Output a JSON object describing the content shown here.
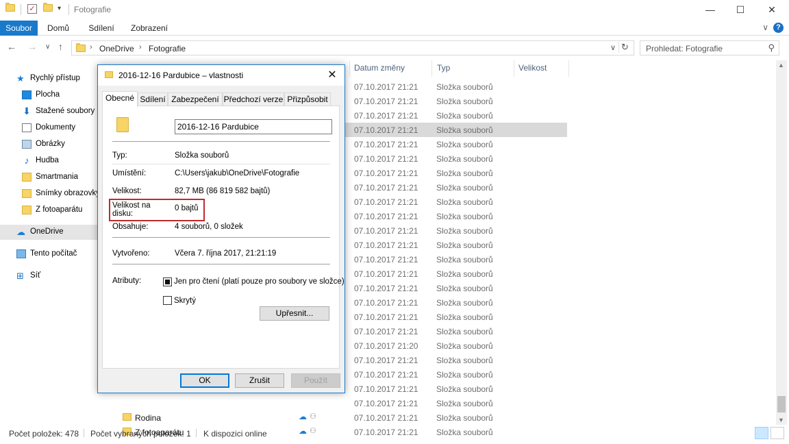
{
  "window": {
    "title": "Fotografie",
    "minimize": "—",
    "maximize": "☐",
    "close": "✕"
  },
  "ribbon": {
    "tabs": [
      "Soubor",
      "Domů",
      "Sdílení",
      "Zobrazení"
    ],
    "collapse": "∨",
    "help": "?"
  },
  "address": {
    "crumbs": [
      "OneDrive",
      "Fotografie"
    ],
    "search_placeholder": "Prohledat: Fotografie"
  },
  "nav": {
    "items": [
      {
        "label": "Rychlý přístup",
        "icon": "star-icon"
      },
      {
        "label": "Plocha",
        "icon": "desktop-icon"
      },
      {
        "label": "Stažené soubory",
        "icon": "download-icon"
      },
      {
        "label": "Dokumenty",
        "icon": "documents-icon"
      },
      {
        "label": "Obrázky",
        "icon": "pictures-icon"
      },
      {
        "label": "Hudba",
        "icon": "music-icon"
      },
      {
        "label": "Smartmania",
        "icon": "folder-icon"
      },
      {
        "label": "Snímky obrazovky",
        "icon": "folder-icon"
      },
      {
        "label": "Z fotoaparátu",
        "icon": "folder-icon"
      },
      {
        "label": "OneDrive",
        "icon": "cloud-icon"
      },
      {
        "label": "Tento počítač",
        "icon": "computer-icon"
      },
      {
        "label": "Síť",
        "icon": "network-icon"
      }
    ]
  },
  "columns": {
    "date": "Datum změny",
    "type": "Typ",
    "size": "Velikost"
  },
  "rows": [
    {
      "name": "",
      "date": "07.10.2017 21:21",
      "type": "Složka souborů"
    },
    {
      "name": "",
      "date": "07.10.2017 21:21",
      "type": "Složka souborů"
    },
    {
      "name": "",
      "date": "07.10.2017 21:21",
      "type": "Složka souborů"
    },
    {
      "name": "",
      "date": "07.10.2017 21:21",
      "type": "Složka souborů"
    },
    {
      "name": "",
      "date": "07.10.2017 21:21",
      "type": "Složka souborů"
    },
    {
      "name": "",
      "date": "07.10.2017 21:21",
      "type": "Složka souborů"
    },
    {
      "name": "",
      "date": "07.10.2017 21:21",
      "type": "Složka souborů"
    },
    {
      "name": "",
      "date": "07.10.2017 21:21",
      "type": "Složka souborů"
    },
    {
      "name": "",
      "date": "07.10.2017 21:21",
      "type": "Složka souborů"
    },
    {
      "name": "",
      "date": "07.10.2017 21:21",
      "type": "Složka souborů"
    },
    {
      "name": "",
      "date": "07.10.2017 21:21",
      "type": "Složka souborů"
    },
    {
      "name": "",
      "date": "07.10.2017 21:21",
      "type": "Složka souborů"
    },
    {
      "name": "",
      "date": "07.10.2017 21:21",
      "type": "Složka souborů"
    },
    {
      "name": "",
      "date": "07.10.2017 21:21",
      "type": "Složka souborů"
    },
    {
      "name": "",
      "date": "07.10.2017 21:21",
      "type": "Složka souborů"
    },
    {
      "name": "",
      "date": "07.10.2017 21:21",
      "type": "Složka souborů"
    },
    {
      "name": "",
      "date": "07.10.2017 21:21",
      "type": "Složka souborů"
    },
    {
      "name": "",
      "date": "07.10.2017 21:21",
      "type": "Složka souborů"
    },
    {
      "name": "",
      "date": "07.10.2017 21:20",
      "type": "Složka souborů"
    },
    {
      "name": "",
      "date": "07.10.2017 21:21",
      "type": "Složka souborů"
    },
    {
      "name": "",
      "date": "07.10.2017 21:21",
      "type": "Složka souborů"
    },
    {
      "name": "",
      "date": "07.10.2017 21:21",
      "type": "Složka souborů"
    },
    {
      "name": "",
      "date": "07.10.2017 21:21",
      "type": "Složka souborů"
    },
    {
      "name": "Rodina",
      "date": "07.10.2017 21:21",
      "type": "Složka souborů"
    },
    {
      "name": "Z fotoaparátu",
      "date": "07.10.2017 21:21",
      "type": "Složka souborů"
    }
  ],
  "status": {
    "count": "Počet položek: 478",
    "selected": "Počet vybraných položek: 1",
    "availability": "K dispozici online"
  },
  "dialog": {
    "title": "2016-12-16 Pardubice – vlastnosti",
    "close": "✕",
    "tabs": [
      "Obecné",
      "Sdílení",
      "Zabezpečení",
      "Předchozí verze",
      "Přizpůsobit"
    ],
    "name_value": "2016-12-16 Pardubice",
    "type_label": "Typ:",
    "type_value": "Složka souborů",
    "location_label": "Umístění:",
    "location_value": "C:\\Users\\jakub\\OneDrive\\Fotografie",
    "size_label": "Velikost:",
    "size_value": "82,7 MB (86 819 582 bajtů)",
    "disk_label_1": "Velikost na",
    "disk_label_2": "disku:",
    "disk_value": "0 bajtů",
    "contains_label": "Obsahuje:",
    "contains_value": "4 souborů, 0 složek",
    "created_label": "Vytvořeno:",
    "created_value": "Včera 7. října 2017, 21:21:19",
    "attributes_label": "Atributy:",
    "readonly_label": "Jen pro čtení (platí pouze pro soubory ve složce)",
    "hidden_label": "Skrytý",
    "advanced_button": "Upřesnit...",
    "ok_button": "OK",
    "cancel_button": "Zrušit",
    "apply_button": "Použít"
  },
  "colors": {
    "accent": "#1979ca",
    "highlight_box": "#c0282d",
    "folder": "#f6d465"
  }
}
